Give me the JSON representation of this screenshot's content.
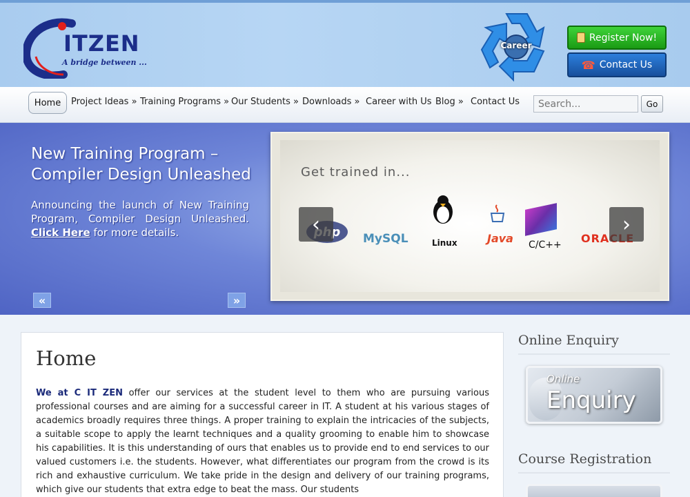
{
  "header": {
    "logo_text": "ITZEN",
    "logo_tagline": "A bridge between ...",
    "career_badge": "Career",
    "register_button": "Register Now!",
    "contact_button": "Contact Us"
  },
  "nav": {
    "items": [
      {
        "label": "Home",
        "active": true
      },
      {
        "label": "Project Ideas »"
      },
      {
        "label": "Training Programs »"
      },
      {
        "label": "Our Students »"
      },
      {
        "label": "Downloads »"
      },
      {
        "label": "Career with Us"
      },
      {
        "label": "Blog »"
      },
      {
        "label": "Contact Us"
      }
    ],
    "search_placeholder": "Search...",
    "search_button": "Go"
  },
  "banner": {
    "title": "New Training Program – Compiler Design Unleashed",
    "desc_before": "Announcing the launch of New Training Program, Compiler Design Unleashed.",
    "link_text": "Click Here",
    "desc_after": "for more details.",
    "prev": "«",
    "next": "»",
    "slide": {
      "heading": "Get trained in...",
      "technologies": [
        "php",
        "MySQL",
        "Linux",
        "Java",
        "C/C++",
        "ORACLE"
      ],
      "prev_arrow": "‹",
      "next_arrow": "›"
    }
  },
  "main": {
    "title": "Home",
    "company": "We at C IT ZEN",
    "body": "offer our services at the student level to them who are pursuing various professional courses and are aiming for a successful career in IT. A student at his various stages of academics broadly requires three things. A proper training to explain the intricacies of the subjects, a suitable scope to apply the learnt techniques and a quality grooming to enable him to showcase his capabilities. It is this understanding of ours that enables us to provide end to end services to our valued customers i.e. the students. However, what differentiates our program from the crowd is its rich and exhaustive curriculum. We take pride in the design and delivery of our training programs, which give our students that extra edge to beat the mass. Our students"
  },
  "sidebar": {
    "enquiry_title": "Online Enquiry",
    "enquiry_small": "Online",
    "enquiry_big": "Enquiry",
    "registration_title": "Course Registration"
  },
  "colors": {
    "brand_navy": "#1c2e8a",
    "register_green": "#1a9b14",
    "contact_blue": "#174f9c",
    "banner_blue": "#6f86d8"
  }
}
